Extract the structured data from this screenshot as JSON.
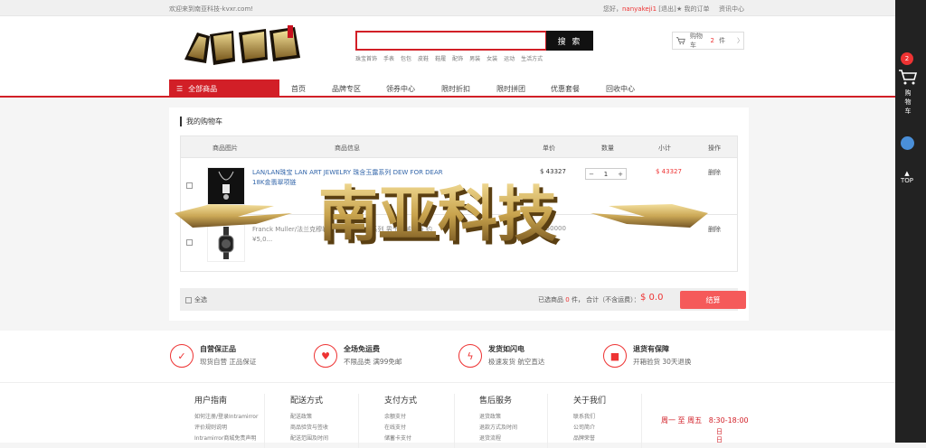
{
  "topbar": {
    "welcome": "欢迎来到南亚科技-kvxr.com!",
    "hello": "您好，",
    "username": "nanyakeji1",
    "logout": "[退出]",
    "my_orders": "★ 我的订单",
    "news": "资讯中心"
  },
  "search": {
    "button": "搜 索",
    "placeholder": ""
  },
  "hotwords": [
    "珠宝首饰",
    "手表",
    "包包",
    "皮鞋",
    "鞋履",
    "配饰",
    "男装",
    "女装",
    "运动",
    "生活方式"
  ],
  "cart_header": {
    "label": "购物车",
    "count": "2",
    "unit": "件",
    "arrow": "〉"
  },
  "nav": {
    "all": "全部商品",
    "links": [
      "首页",
      "品牌专区",
      "领券中心",
      "限时折扣",
      "限时拼团",
      "优惠套餐",
      "回收中心"
    ]
  },
  "sidebar": {
    "badge": "2",
    "cart_text": "购物车",
    "top": "TOP"
  },
  "cart": {
    "title": "我的购物车",
    "columns": [
      "商品图片",
      "商品信息",
      "单价",
      "数量",
      "小计",
      "操作"
    ],
    "rows": [
      {
        "name": "LAN/LAN珠宝 LAN ART JEWELRY 珠含玉露系列 DEW FOR DEAR 18K金翡翠项链",
        "price": "$ 43327",
        "qty": "1",
        "subtotal": "$ 43327",
        "action": "删除"
      },
      {
        "name": "Franck Muller/法兰克穆勒系列Vanguard系列 男士机械腕表 约 ¥5,0...",
        "price": "$ 50000",
        "qty": "1",
        "subtotal": "",
        "action": "删除"
      }
    ],
    "select_all": "全选",
    "selected_label": "已选商品",
    "selected_count": "0",
    "selected_unit": "件，",
    "total_label": "合计（不含运费）：",
    "total": "$ 0.0",
    "settle": "结算",
    "qty_minus": "−",
    "qty_plus": "+"
  },
  "watermark": {
    "text": "南亚科技"
  },
  "services": [
    {
      "title": "自营保正品",
      "desc": "现货自营 正品保证",
      "icon": "shield-check-icon"
    },
    {
      "title": "全场免运费",
      "desc": "不限品类 满99免邮",
      "icon": "hand-heart-icon"
    },
    {
      "title": "发货如闪电",
      "desc": "极速发货 航空直达",
      "icon": "lightning-icon"
    },
    {
      "title": "退货有保障",
      "desc": "开箱验货 30天退换",
      "icon": "truck-icon"
    }
  ],
  "footer_cols": [
    {
      "head": "用户指南",
      "items": [
        "如何注册/登录Intramirror",
        "评价规则说明",
        "Intramirror商城免责声明"
      ]
    },
    {
      "head": "配送方式",
      "items": [
        "配送政策",
        "商品验货与签收",
        "配送范围及时间"
      ]
    },
    {
      "head": "支付方式",
      "items": [
        "余额支付",
        "在线支付",
        "储蓄卡支付"
      ]
    },
    {
      "head": "售后服务",
      "items": [
        "退货政策",
        "退款方式及时间",
        "退货流程"
      ]
    },
    {
      "head": "关于我们",
      "items": [
        "联系我们",
        "公司简介",
        "品牌荣誉"
      ]
    }
  ],
  "hours": {
    "days": "周一 至 周五",
    "time": "8:30-18:00",
    "tail": "日\n日"
  },
  "colors": {
    "accent": "#d21f27",
    "price": "#e33",
    "settle": "#f55a5a"
  }
}
